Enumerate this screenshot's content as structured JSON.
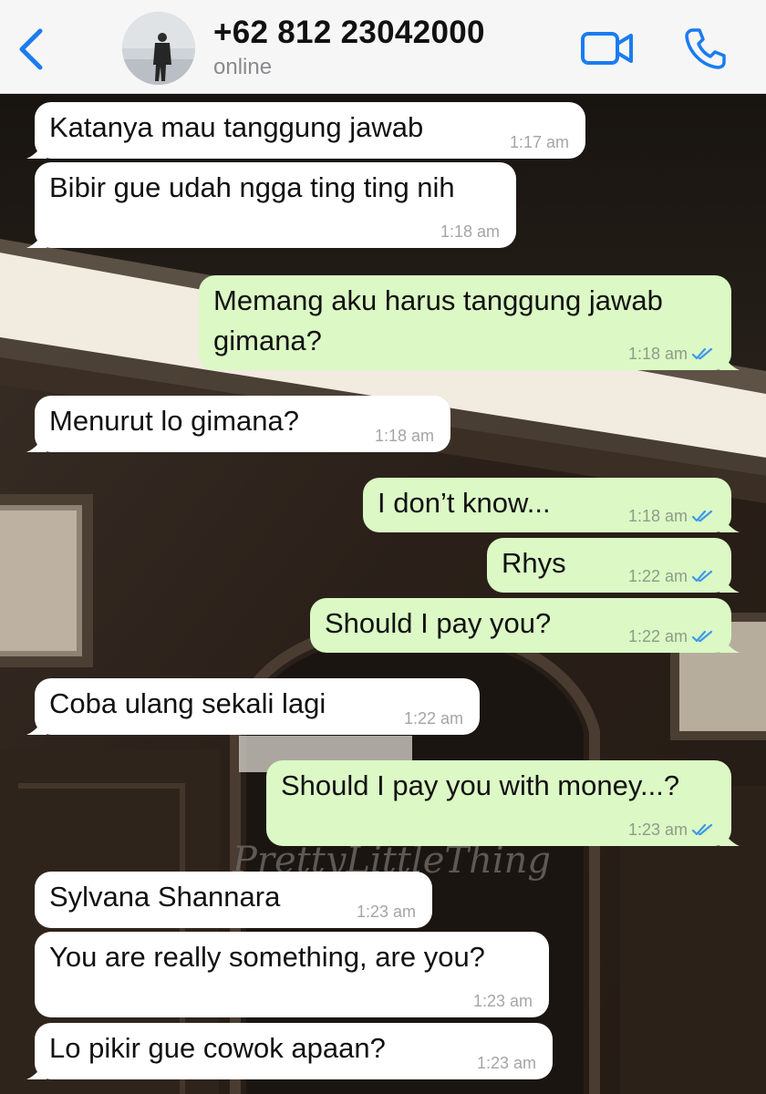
{
  "header": {
    "contact_name": "+62 812 23042000",
    "status": "online",
    "icons": {
      "back": "chevron-left-icon",
      "video": "video-camera-icon",
      "call": "phone-icon"
    },
    "accent_color": "#1a7cf0"
  },
  "colors": {
    "incoming_bubble": "#ffffff",
    "outgoing_bubble": "#dbf8c5",
    "read_ticks": "#3d9ae8"
  },
  "wallpaper": {
    "watermark": "PrettyLittleThing"
  },
  "messages": [
    {
      "direction": "in",
      "text": "Katanya mau tanggung jawab",
      "time": "1:17 am"
    },
    {
      "direction": "in",
      "text": "Bibir gue udah ngga ting ting nih",
      "time": "1:18 am"
    },
    {
      "direction": "out",
      "text": "Memang aku harus tanggung jawab gimana?",
      "time": "1:18 am",
      "status": "read"
    },
    {
      "direction": "in",
      "text": "Menurut lo gimana?",
      "time": "1:18 am"
    },
    {
      "direction": "out",
      "text": "I don’t know...",
      "time": "1:18 am",
      "status": "read"
    },
    {
      "direction": "out",
      "text": "Rhys",
      "time": "1:22 am",
      "status": "read"
    },
    {
      "direction": "out",
      "text": "Should I pay you?",
      "time": "1:22 am",
      "status": "read"
    },
    {
      "direction": "in",
      "text": "Coba ulang sekali lagi",
      "time": "1:22 am"
    },
    {
      "direction": "out",
      "text": "Should I pay you with money...?",
      "time": "1:23 am",
      "status": "read"
    },
    {
      "direction": "in",
      "text": "Sylvana Shannara",
      "time": "1:23 am"
    },
    {
      "direction": "in",
      "text": "You are really something, are you?",
      "time": "1:23 am"
    },
    {
      "direction": "in",
      "text": "Lo pikir gue cowok apaan?",
      "time": "1:23 am"
    }
  ]
}
